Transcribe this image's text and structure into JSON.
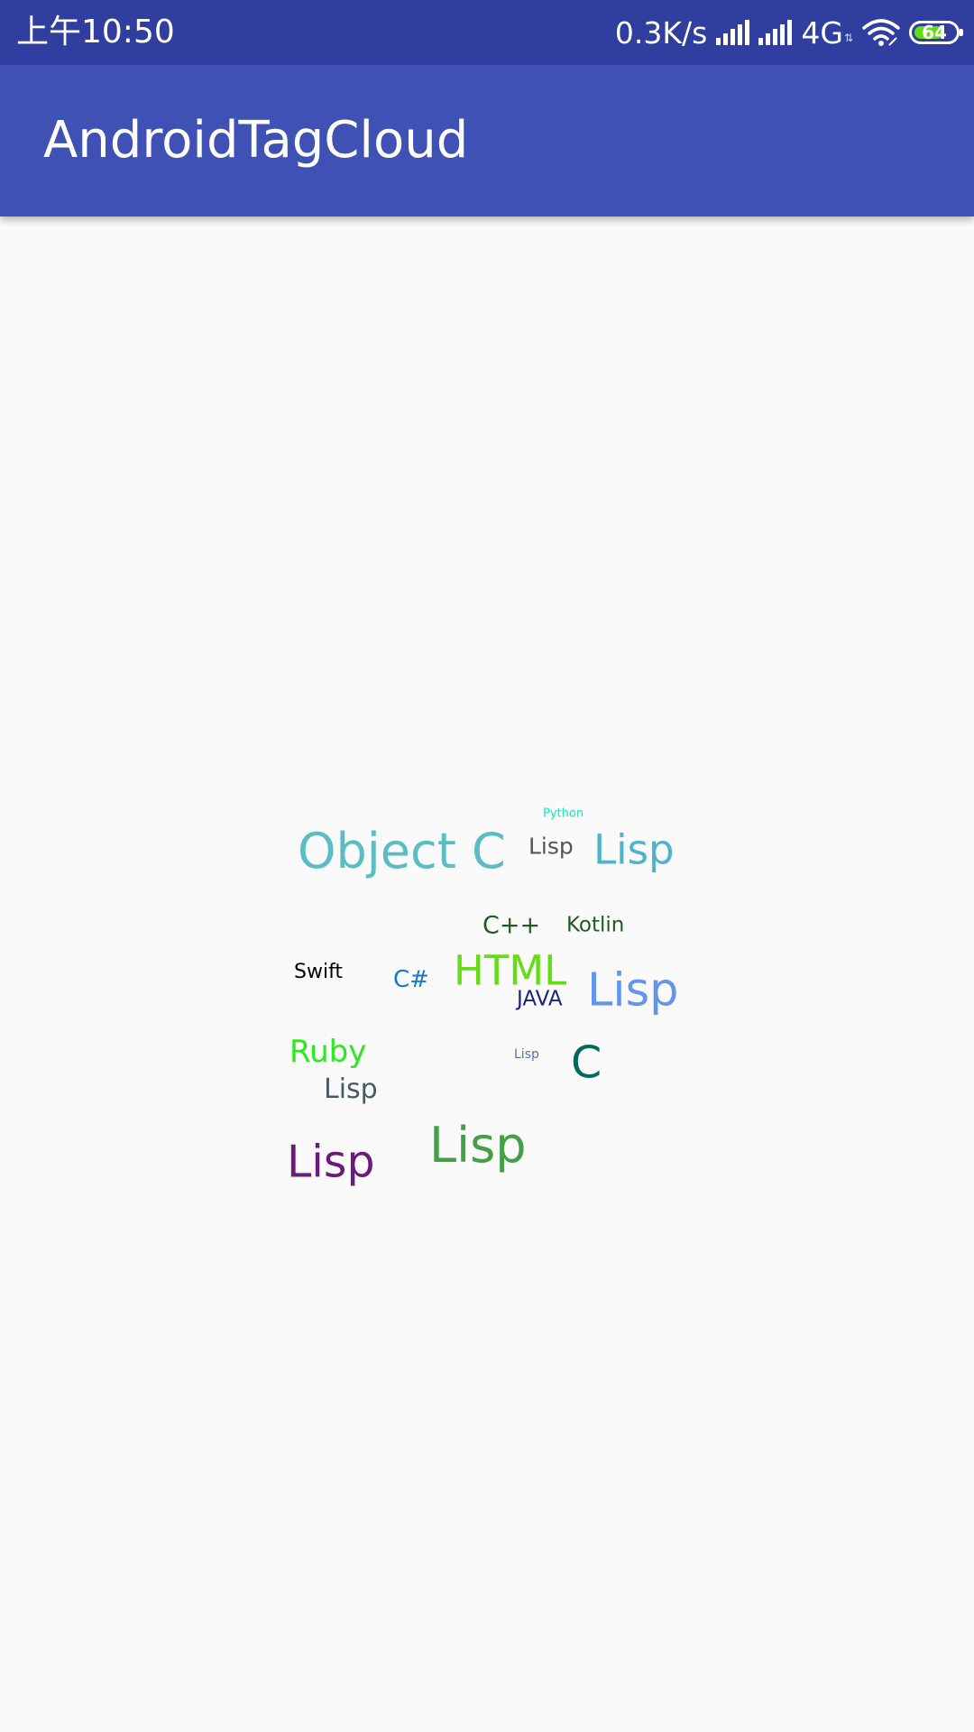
{
  "status_bar": {
    "time": "上午10:50",
    "net_speed": "0.3K/s",
    "network_type": "4G",
    "network_arrows": "⇅",
    "battery_level": "64",
    "icons": [
      "signal-icon",
      "signal-icon",
      "wifi-icon",
      "battery-icon"
    ]
  },
  "app_bar": {
    "title": "AndroidTagCloud"
  },
  "tag_cloud": {
    "tags": [
      {
        "text": "Python",
        "color": "#1de9b6"
      },
      {
        "text": "Object C",
        "color": "#5bbdc4"
      },
      {
        "text": "Lisp",
        "color": "#555555"
      },
      {
        "text": "Lisp",
        "color": "#4fb3cc"
      },
      {
        "text": "C++",
        "color": "#1b5e20"
      },
      {
        "text": "Kotlin",
        "color": "#1b5e20"
      },
      {
        "text": "Swift",
        "color": "#000000"
      },
      {
        "text": "C#",
        "color": "#1976d2"
      },
      {
        "text": "HTML",
        "color": "#64dd17"
      },
      {
        "text": "JAVA",
        "color": "#1a237e"
      },
      {
        "text": "Lisp",
        "color": "#6495ed"
      },
      {
        "text": "Ruby",
        "color": "#2ee81f"
      },
      {
        "text": "Lisp",
        "color": "#5c6bc0"
      },
      {
        "text": "C",
        "color": "#00695c"
      },
      {
        "text": "Lisp",
        "color": "#455a64"
      },
      {
        "text": "Lisp",
        "color": "#6a1b7a"
      },
      {
        "text": "Lisp",
        "color": "#43a047"
      }
    ]
  }
}
